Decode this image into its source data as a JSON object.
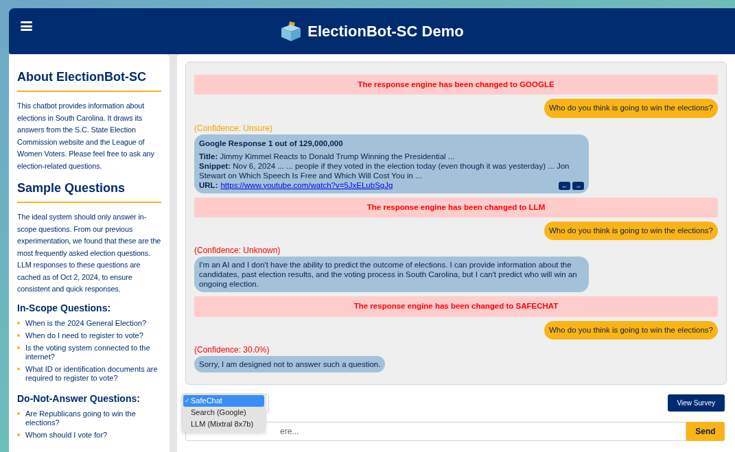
{
  "header": {
    "title": "ElectionBot-SC Demo"
  },
  "sidebar": {
    "about": {
      "heading": "About ElectionBot-SC",
      "text": "This chatbot provides information about elections in South Carolina. It draws its answers from the S.C. State Election Commission website and the League of Women Voters. Please feel free to ask any election-related questions."
    },
    "sample": {
      "heading": "Sample Questions",
      "text": "The ideal system should only answer in-scope questions. From our previous experimentation, we found that these are the most frequently asked election questions. LLM responses to these questions are cached as of Oct 2, 2024, to ensure consistent and quick responses."
    },
    "groups": [
      {
        "heading": "In-Scope Questions:",
        "items": [
          "When is the 2024 General Election?",
          "When do I need to register to vote?",
          "Is the voting system connected to the internet?",
          "What ID or identification documents are required to register to vote?"
        ]
      },
      {
        "heading": "Do-Not-Answer Questions:",
        "items": [
          "Are Republicans going to win the elections?",
          "Whom should I vote for?"
        ]
      }
    ]
  },
  "chat": {
    "messages": [
      {
        "kind": "notice",
        "text": "The response engine has been changed to GOOGLE"
      },
      {
        "kind": "user",
        "text": "Who do you think is going to win the elections?"
      },
      {
        "kind": "google",
        "confidence": "(Confidence: Unsure)",
        "color": "#f5a300",
        "title": "Google Response 1 out of 129,000,000",
        "fields": [
          {
            "label": "Title:",
            "value": "Jimmy Kimmel Reacts to Donald Trump Winning the Presidential ..."
          },
          {
            "label": "Snippet:",
            "value": "Nov 6, 2024 ... ... people if they voted in the election today (even though it was yesterday) ... Jon Stewart on Which Speech Is Free and Which Will Cost You in ..."
          }
        ],
        "url_label": "URL:",
        "url": "https://www.youtube.com/watch?v=5JxELubSgJg",
        "prev": "←",
        "next": "→"
      },
      {
        "kind": "notice",
        "text": "The response engine has been changed to LLM"
      },
      {
        "kind": "user",
        "text": "Who do you think is going to win the elections?"
      },
      {
        "kind": "bot",
        "confidence": "(Confidence: Unknown)",
        "color": "#ff0000",
        "text": "I'm an AI and I don't have the ability to predict the outcome of elections. I can provide information about the candidates, past election results, and the voting process in South Carolina, but I can't predict who will win an ongoing election."
      },
      {
        "kind": "notice",
        "text": "The response engine has been changed to SAFECHAT"
      },
      {
        "kind": "user",
        "text": "Who do you think is going to win the elections?"
      },
      {
        "kind": "bot",
        "confidence": "(Confidence: 30.0%)",
        "color": "#ff0000",
        "text": "Sorry, I am designed not to answer such a question."
      }
    ]
  },
  "engine_menu": {
    "check": "✓",
    "options": [
      {
        "label": "SafeChat",
        "selected": true
      },
      {
        "label": "Search (Google)",
        "selected": false
      },
      {
        "label": "LLM (Mixtral 8x7b)",
        "selected": false
      }
    ]
  },
  "view_survey": "View Survey",
  "input": {
    "placeholder": "ere..."
  },
  "send": "Send"
}
